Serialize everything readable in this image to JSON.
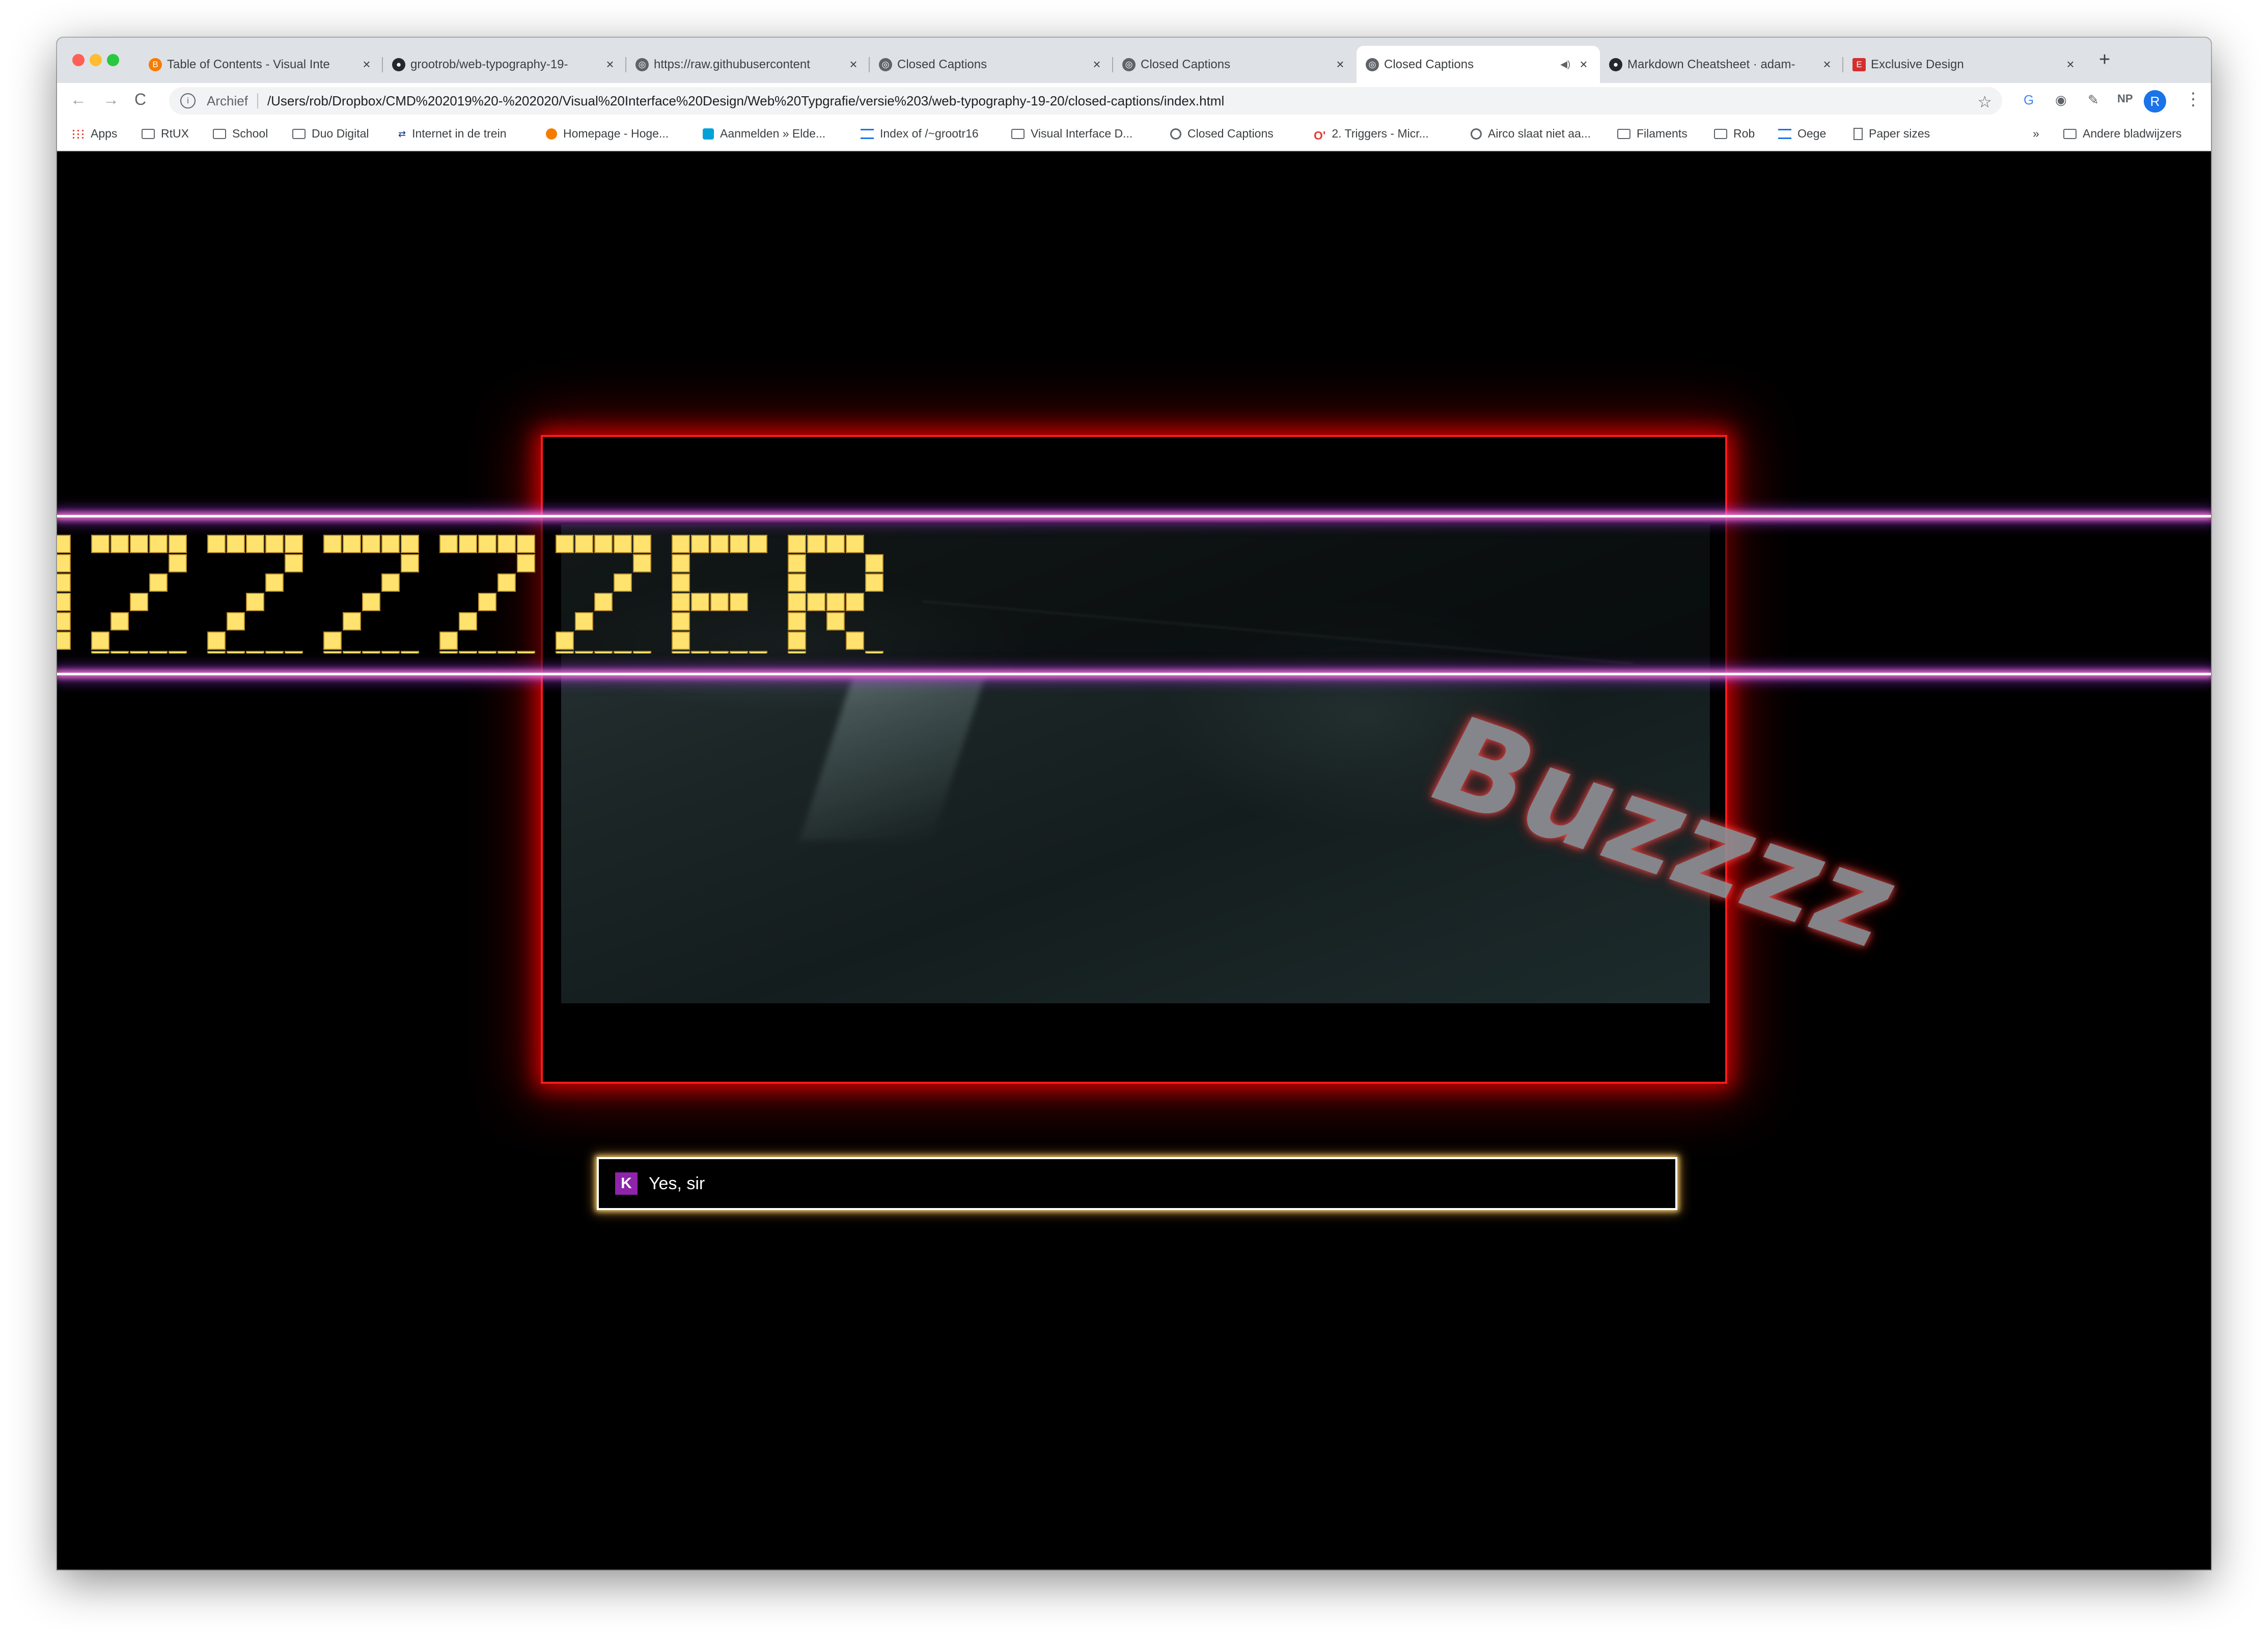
{
  "tabs": [
    {
      "title": "Table of Contents - Visual Inte",
      "icon": "blogger-icon",
      "color": "#f57c00",
      "active": false
    },
    {
      "title": "grootrob/web-typography-19-",
      "icon": "github-icon",
      "color": "#24292e",
      "active": false
    },
    {
      "title": "https://raw.githubusercontent",
      "icon": "globe-icon",
      "color": "#5f6368",
      "active": false
    },
    {
      "title": "Closed Captions",
      "icon": "globe-icon",
      "color": "#5f6368",
      "active": false
    },
    {
      "title": "Closed Captions",
      "icon": "globe-icon",
      "color": "#5f6368",
      "active": false
    },
    {
      "title": "Closed Captions",
      "icon": "globe-icon",
      "color": "#5f6368",
      "active": true,
      "audio": true
    },
    {
      "title": "Markdown Cheatsheet · adam-",
      "icon": "github-icon",
      "color": "#24292e",
      "active": false
    },
    {
      "title": "Exclusive Design",
      "icon": "exclusive-design-icon",
      "color": "#d32f2f",
      "active": false
    }
  ],
  "new_tab_label": "+",
  "toolbar": {
    "back": "←",
    "forward": "→",
    "reload": "C",
    "security_label": "Archief",
    "url": "/Users/rob/Dropbox/CMD%202019%20-%202020/Visual%20Interface%20Design/Web%20Typgrafie/versie%203/web-typography-19-20/closed-captions/index.html",
    "star": "☆",
    "profile_initial": "R",
    "extensions": [
      "G",
      "◉",
      "✎",
      "NP",
      "≡"
    ],
    "menu": "⋮"
  },
  "bookmarks": [
    {
      "label": "Apps",
      "type": "apps"
    },
    {
      "label": "RtUX",
      "type": "folder"
    },
    {
      "label": "School",
      "type": "folder"
    },
    {
      "label": "Duo Digital",
      "type": "folder"
    },
    {
      "label": "Internet in de trein",
      "type": "link"
    },
    {
      "label": "Homepage - Hoge...",
      "type": "link"
    },
    {
      "label": "Aanmelden » Elde...",
      "type": "link"
    },
    {
      "label": "Index of /~grootr16",
      "type": "link"
    },
    {
      "label": "Visual Interface D...",
      "type": "folder"
    },
    {
      "label": "Closed Captions",
      "type": "link"
    },
    {
      "label": "2. Triggers - Micr...",
      "type": "link"
    },
    {
      "label": "Airco slaat niet aa...",
      "type": "link"
    },
    {
      "label": "Filaments",
      "type": "folder"
    },
    {
      "label": "Rob",
      "type": "folder"
    },
    {
      "label": "Oege",
      "type": "link"
    },
    {
      "label": "Paper sizes",
      "type": "link"
    }
  ],
  "bookmarks_overflow": "»",
  "other_bookmarks": "Andere bladwijzers",
  "page": {
    "marquee_text": "UZZZZZER",
    "marquee_color": "#ffe36e",
    "buzz_text": "Buzzzz",
    "caption_speaker": "K",
    "caption_text": "Yes, sir",
    "frame_color": "#ff1a1a",
    "speaker_color": "#8e24aa"
  }
}
